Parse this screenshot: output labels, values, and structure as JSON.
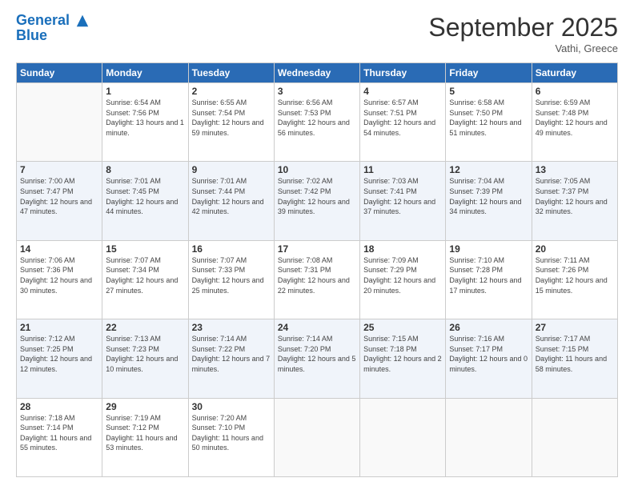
{
  "logo": {
    "line1": "General",
    "line2": "Blue"
  },
  "title": "September 2025",
  "location": "Vathi, Greece",
  "days_of_week": [
    "Sunday",
    "Monday",
    "Tuesday",
    "Wednesday",
    "Thursday",
    "Friday",
    "Saturday"
  ],
  "weeks": [
    [
      {
        "day": "",
        "sunrise": "",
        "sunset": "",
        "daylight": ""
      },
      {
        "day": "1",
        "sunrise": "Sunrise: 6:54 AM",
        "sunset": "Sunset: 7:56 PM",
        "daylight": "Daylight: 13 hours and 1 minute."
      },
      {
        "day": "2",
        "sunrise": "Sunrise: 6:55 AM",
        "sunset": "Sunset: 7:54 PM",
        "daylight": "Daylight: 12 hours and 59 minutes."
      },
      {
        "day": "3",
        "sunrise": "Sunrise: 6:56 AM",
        "sunset": "Sunset: 7:53 PM",
        "daylight": "Daylight: 12 hours and 56 minutes."
      },
      {
        "day": "4",
        "sunrise": "Sunrise: 6:57 AM",
        "sunset": "Sunset: 7:51 PM",
        "daylight": "Daylight: 12 hours and 54 minutes."
      },
      {
        "day": "5",
        "sunrise": "Sunrise: 6:58 AM",
        "sunset": "Sunset: 7:50 PM",
        "daylight": "Daylight: 12 hours and 51 minutes."
      },
      {
        "day": "6",
        "sunrise": "Sunrise: 6:59 AM",
        "sunset": "Sunset: 7:48 PM",
        "daylight": "Daylight: 12 hours and 49 minutes."
      }
    ],
    [
      {
        "day": "7",
        "sunrise": "Sunrise: 7:00 AM",
        "sunset": "Sunset: 7:47 PM",
        "daylight": "Daylight: 12 hours and 47 minutes."
      },
      {
        "day": "8",
        "sunrise": "Sunrise: 7:01 AM",
        "sunset": "Sunset: 7:45 PM",
        "daylight": "Daylight: 12 hours and 44 minutes."
      },
      {
        "day": "9",
        "sunrise": "Sunrise: 7:01 AM",
        "sunset": "Sunset: 7:44 PM",
        "daylight": "Daylight: 12 hours and 42 minutes."
      },
      {
        "day": "10",
        "sunrise": "Sunrise: 7:02 AM",
        "sunset": "Sunset: 7:42 PM",
        "daylight": "Daylight: 12 hours and 39 minutes."
      },
      {
        "day": "11",
        "sunrise": "Sunrise: 7:03 AM",
        "sunset": "Sunset: 7:41 PM",
        "daylight": "Daylight: 12 hours and 37 minutes."
      },
      {
        "day": "12",
        "sunrise": "Sunrise: 7:04 AM",
        "sunset": "Sunset: 7:39 PM",
        "daylight": "Daylight: 12 hours and 34 minutes."
      },
      {
        "day": "13",
        "sunrise": "Sunrise: 7:05 AM",
        "sunset": "Sunset: 7:37 PM",
        "daylight": "Daylight: 12 hours and 32 minutes."
      }
    ],
    [
      {
        "day": "14",
        "sunrise": "Sunrise: 7:06 AM",
        "sunset": "Sunset: 7:36 PM",
        "daylight": "Daylight: 12 hours and 30 minutes."
      },
      {
        "day": "15",
        "sunrise": "Sunrise: 7:07 AM",
        "sunset": "Sunset: 7:34 PM",
        "daylight": "Daylight: 12 hours and 27 minutes."
      },
      {
        "day": "16",
        "sunrise": "Sunrise: 7:07 AM",
        "sunset": "Sunset: 7:33 PM",
        "daylight": "Daylight: 12 hours and 25 minutes."
      },
      {
        "day": "17",
        "sunrise": "Sunrise: 7:08 AM",
        "sunset": "Sunset: 7:31 PM",
        "daylight": "Daylight: 12 hours and 22 minutes."
      },
      {
        "day": "18",
        "sunrise": "Sunrise: 7:09 AM",
        "sunset": "Sunset: 7:29 PM",
        "daylight": "Daylight: 12 hours and 20 minutes."
      },
      {
        "day": "19",
        "sunrise": "Sunrise: 7:10 AM",
        "sunset": "Sunset: 7:28 PM",
        "daylight": "Daylight: 12 hours and 17 minutes."
      },
      {
        "day": "20",
        "sunrise": "Sunrise: 7:11 AM",
        "sunset": "Sunset: 7:26 PM",
        "daylight": "Daylight: 12 hours and 15 minutes."
      }
    ],
    [
      {
        "day": "21",
        "sunrise": "Sunrise: 7:12 AM",
        "sunset": "Sunset: 7:25 PM",
        "daylight": "Daylight: 12 hours and 12 minutes."
      },
      {
        "day": "22",
        "sunrise": "Sunrise: 7:13 AM",
        "sunset": "Sunset: 7:23 PM",
        "daylight": "Daylight: 12 hours and 10 minutes."
      },
      {
        "day": "23",
        "sunrise": "Sunrise: 7:14 AM",
        "sunset": "Sunset: 7:22 PM",
        "daylight": "Daylight: 12 hours and 7 minutes."
      },
      {
        "day": "24",
        "sunrise": "Sunrise: 7:14 AM",
        "sunset": "Sunset: 7:20 PM",
        "daylight": "Daylight: 12 hours and 5 minutes."
      },
      {
        "day": "25",
        "sunrise": "Sunrise: 7:15 AM",
        "sunset": "Sunset: 7:18 PM",
        "daylight": "Daylight: 12 hours and 2 minutes."
      },
      {
        "day": "26",
        "sunrise": "Sunrise: 7:16 AM",
        "sunset": "Sunset: 7:17 PM",
        "daylight": "Daylight: 12 hours and 0 minutes."
      },
      {
        "day": "27",
        "sunrise": "Sunrise: 7:17 AM",
        "sunset": "Sunset: 7:15 PM",
        "daylight": "Daylight: 11 hours and 58 minutes."
      }
    ],
    [
      {
        "day": "28",
        "sunrise": "Sunrise: 7:18 AM",
        "sunset": "Sunset: 7:14 PM",
        "daylight": "Daylight: 11 hours and 55 minutes."
      },
      {
        "day": "29",
        "sunrise": "Sunrise: 7:19 AM",
        "sunset": "Sunset: 7:12 PM",
        "daylight": "Daylight: 11 hours and 53 minutes."
      },
      {
        "day": "30",
        "sunrise": "Sunrise: 7:20 AM",
        "sunset": "Sunset: 7:10 PM",
        "daylight": "Daylight: 11 hours and 50 minutes."
      },
      {
        "day": "",
        "sunrise": "",
        "sunset": "",
        "daylight": ""
      },
      {
        "day": "",
        "sunrise": "",
        "sunset": "",
        "daylight": ""
      },
      {
        "day": "",
        "sunrise": "",
        "sunset": "",
        "daylight": ""
      },
      {
        "day": "",
        "sunrise": "",
        "sunset": "",
        "daylight": ""
      }
    ]
  ]
}
